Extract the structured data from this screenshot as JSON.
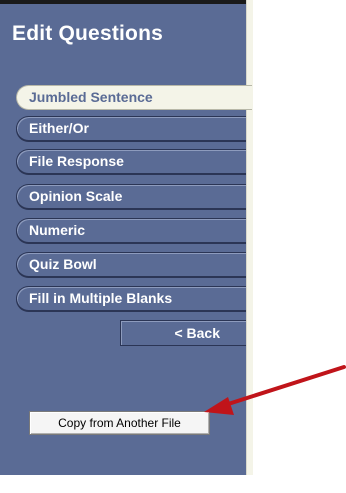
{
  "sidebar": {
    "title": "Edit Questions",
    "items": [
      {
        "label": "Jumbled Sentence",
        "active": true
      },
      {
        "label": "Either/Or",
        "active": false
      },
      {
        "label": "File Response",
        "active": false
      },
      {
        "label": "Opinion Scale",
        "active": false
      },
      {
        "label": "Numeric",
        "active": false
      },
      {
        "label": "Quiz Bowl",
        "active": false
      },
      {
        "label": "Fill in Multiple Blanks",
        "active": false
      }
    ],
    "back_label": "< Back",
    "copy_label": "Copy from Another File"
  },
  "colors": {
    "panel": "#5a6b95",
    "active_tab": "#f4f4e8",
    "arrow": "#c0141a"
  }
}
